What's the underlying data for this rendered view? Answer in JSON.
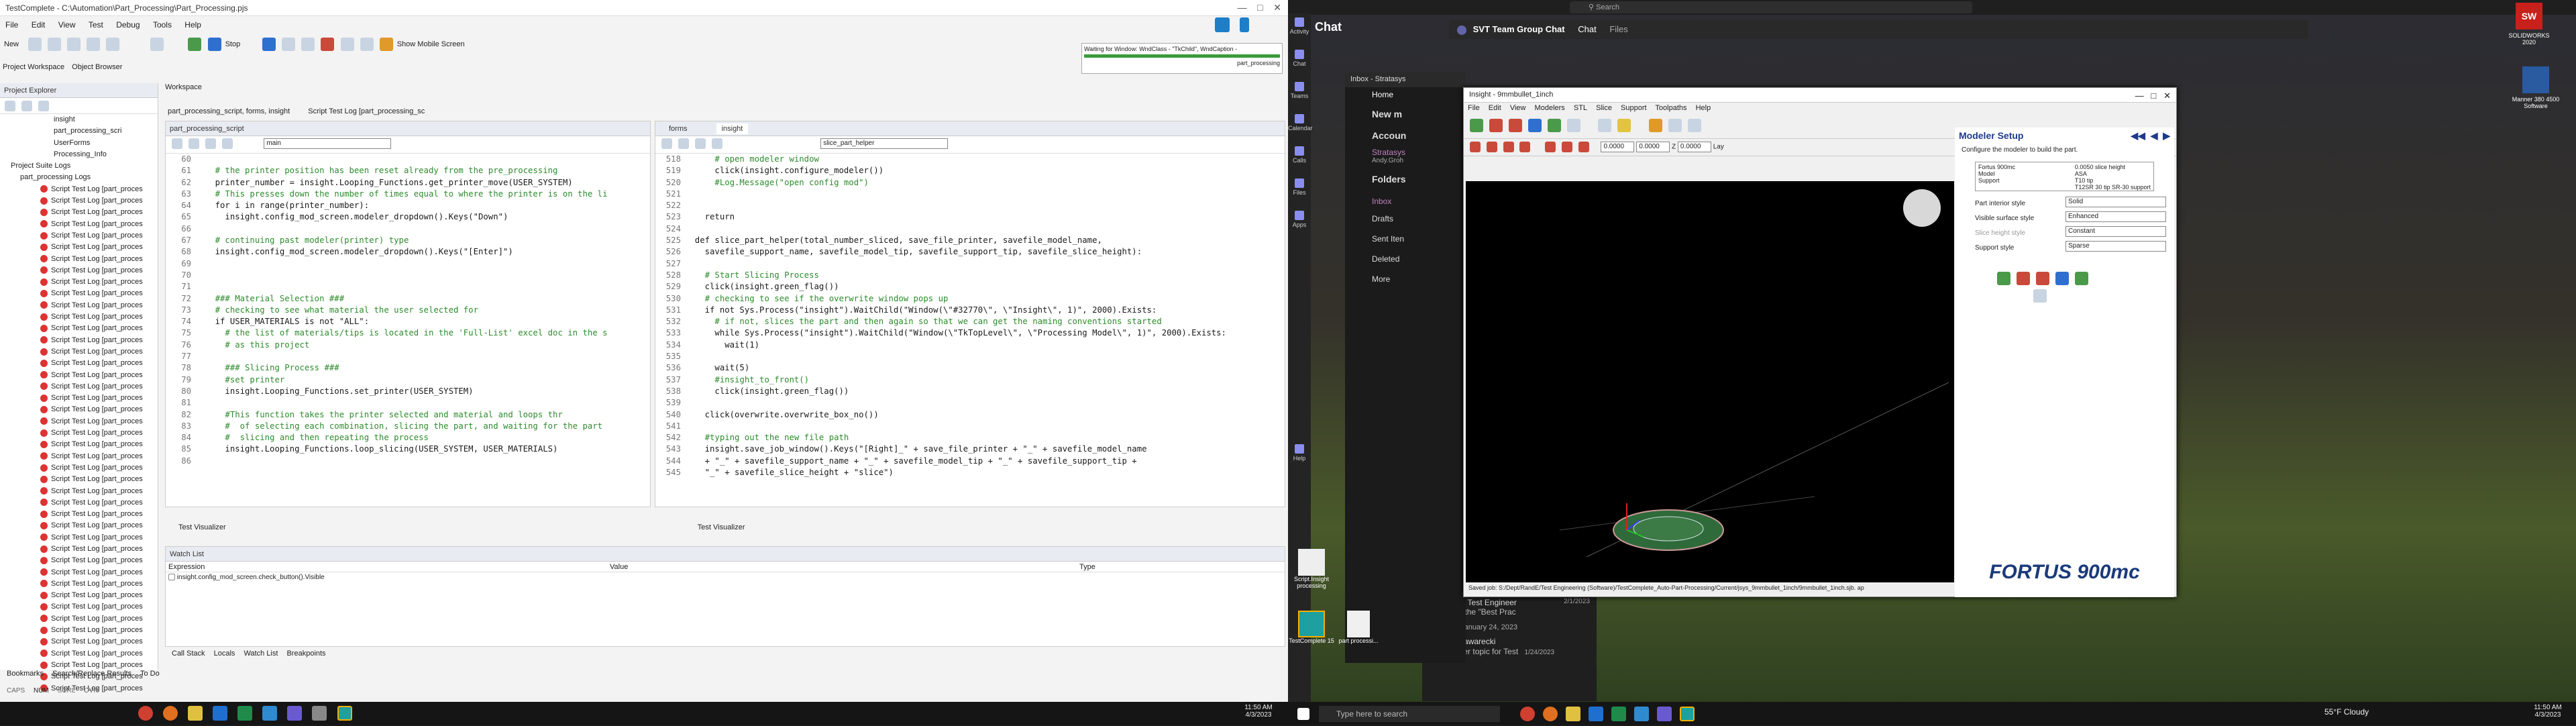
{
  "left_window": {
    "title": "TestComplete - C:\\Automation\\Part_Processing\\Part_Processing.pjs",
    "menu": [
      "File",
      "Edit",
      "View",
      "Test",
      "Debug",
      "Tools",
      "Help"
    ],
    "toolbar": {
      "new_label": "New",
      "run_label": "Run",
      "stop_label": "Stop",
      "mobile_label": "Show Mobile Screen"
    },
    "waiting_text": "Waiting for Window: WndClass - \"TkChild\", WndCaption -",
    "waiting_sub": "part_processing",
    "tabs_left": [
      "Project Workspace",
      "Object Browser"
    ],
    "workspace_label": "Workspace",
    "project_explorer": {
      "title": "Project Explorer",
      "items_top": [
        "insight",
        "part_processing_scri",
        "UserForms",
        "Processing_Info"
      ],
      "suite_logs": "Project Suite Logs",
      "logs_parent": "part_processing Logs",
      "log_item": "Script Test Log [part_proces",
      "log_count": 44
    },
    "editor_tabs": [
      "part_processing_script, forms, insight",
      "Script Test Log [part_processing_sc"
    ],
    "left_editor": {
      "tab": "part_processing_script",
      "routine": "main",
      "lines": [
        {
          "n": "60",
          "t": ""
        },
        {
          "n": "61",
          "t": "    # the printer position has been reset already from the pre_processing",
          "c": "cmt"
        },
        {
          "n": "62",
          "t": "    printer_number = insight.Looping_Functions.get_printer_move(USER_SYSTEM)"
        },
        {
          "n": "63",
          "t": "    # This presses down the number of times equal to where the printer is on the li",
          "c": "cmt"
        },
        {
          "n": "64",
          "t": "    for i in range(printer_number):"
        },
        {
          "n": "65",
          "t": "      insight.config_mod_screen.modeler_dropdown().Keys(\"Down\")"
        },
        {
          "n": "66",
          "t": ""
        },
        {
          "n": "67",
          "t": "    # continuing past modeler(printer) type",
          "c": "cmt"
        },
        {
          "n": "68",
          "t": "    insight.config_mod_screen.modeler_dropdown().Keys(\"[Enter]\")"
        },
        {
          "n": "69",
          "t": ""
        },
        {
          "n": "70",
          "t": ""
        },
        {
          "n": "71",
          "t": ""
        },
        {
          "n": "72",
          "t": "    ### Material Selection ###",
          "c": "cmt"
        },
        {
          "n": "73",
          "t": "    # checking to see what material the user selected for",
          "c": "cmt"
        },
        {
          "n": "74",
          "t": "    if USER_MATERIALS is not \"ALL\":"
        },
        {
          "n": "75",
          "t": "      # the list of materials/tips is located in the 'Full-List' excel doc in the s",
          "c": "cmt"
        },
        {
          "n": "76",
          "t": "      # as this project",
          "c": "cmt"
        },
        {
          "n": "77",
          "t": ""
        },
        {
          "n": "78",
          "t": "      ### Slicing Process ###",
          "c": "cmt"
        },
        {
          "n": "79",
          "t": "      #set printer",
          "c": "cmt"
        },
        {
          "n": "80",
          "t": "      insight.Looping_Functions.set_printer(USER_SYSTEM)"
        },
        {
          "n": "81",
          "t": ""
        },
        {
          "n": "82",
          "t": "      #This function takes the printer selected and material and loops thr",
          "c": "cmt"
        },
        {
          "n": "83",
          "t": "      #  of selecting each combination, slicing the part, and waiting for the part",
          "c": "cmt"
        },
        {
          "n": "84",
          "t": "      #  slicing and then repeating the process",
          "c": "cmt"
        },
        {
          "n": "85",
          "t": "      insight.Looping_Functions.loop_slicing(USER_SYSTEM, USER_MATERIALS)"
        },
        {
          "n": "86",
          "t": ""
        }
      ]
    },
    "right_editor": {
      "tabs": [
        "forms",
        "insight"
      ],
      "routine": "slice_part_helper",
      "lines": [
        {
          "n": "518",
          "t": "      # open modeler window",
          "c": "cmt"
        },
        {
          "n": "519",
          "t": "      click(insight.configure_modeler())"
        },
        {
          "n": "520",
          "t": "      #Log.Message(\"open config mod\")",
          "c": "cmt"
        },
        {
          "n": "521",
          "t": ""
        },
        {
          "n": "522",
          "t": ""
        },
        {
          "n": "523",
          "t": "    return"
        },
        {
          "n": "524",
          "t": ""
        },
        {
          "n": "525",
          "t": "  def slice_part_helper(total_number_sliced, save_file_printer, savefile_model_name,"
        },
        {
          "n": "526",
          "t": "    savefile_support_name, savefile_model_tip, savefile_support_tip, savefile_slice_height):"
        },
        {
          "n": "527",
          "t": ""
        },
        {
          "n": "528",
          "t": "    # Start Slicing Process",
          "c": "cmt"
        },
        {
          "n": "529",
          "t": "    click(insight.green_flag())"
        },
        {
          "n": "530",
          "t": "    # checking to see if the overwrite window pops up",
          "c": "cmt"
        },
        {
          "n": "531",
          "t": "    if not Sys.Process(\"insight\").WaitChild(\"Window(\\\"#32770\\\", \\\"Insight\\\", 1)\", 2000).Exists:"
        },
        {
          "n": "532",
          "t": "      # if not, slices the part and then again so that we can get the naming conventions started",
          "c": "cmt"
        },
        {
          "n": "533",
          "t": "      while Sys.Process(\"insight\").WaitChild(\"Window(\\\"TkTopLevel\\\", \\\"Processing Model\\\", 1)\", 2000).Exists:"
        },
        {
          "n": "534",
          "t": "        wait(1)"
        },
        {
          "n": "535",
          "t": ""
        },
        {
          "n": "536",
          "t": "      wait(5)"
        },
        {
          "n": "537",
          "t": "      #insight_to_front()",
          "c": "cmt"
        },
        {
          "n": "538",
          "t": "      click(insight.green_flag())"
        },
        {
          "n": "539",
          "t": ""
        },
        {
          "n": "540",
          "t": "    click(overwrite.overwrite_box_no())"
        },
        {
          "n": "541",
          "t": ""
        },
        {
          "n": "542",
          "t": "    #typing out the new file path",
          "c": "cmt"
        },
        {
          "n": "543",
          "t": "    insight.save_job_window().Keys(\"[Right]_\" + save_file_printer + \"_\" + savefile_model_name"
        },
        {
          "n": "544",
          "t": "    + \"_\" + savefile_support_name + \"_\" + savefile_model_tip + \"_\" + savefile_support_tip +"
        },
        {
          "n": "545",
          "t": "    \"_\" + savefile_slice_height + \"slice\")"
        }
      ]
    },
    "test_visualizer_label": "Test Visualizer",
    "watch": {
      "title": "Watch List",
      "cols": [
        "Expression",
        "Value",
        "Type"
      ],
      "row": "insight.config_mod_screen.check_button().Visible"
    },
    "bottom_tabs": [
      "Call Stack",
      "Locals",
      "Watch List",
      "Breakpoints"
    ],
    "footer_tabs": [
      "Bookmarks",
      "Search/Replace Results",
      "To Do"
    ],
    "status": [
      "CAPS",
      "NUM",
      "SCRL",
      "OVR"
    ]
  },
  "left_taskbar": {
    "time": "11:50 AM",
    "date": "4/3/2023"
  },
  "right_monitor": {
    "search_placeholder": "Search",
    "teams": {
      "chat_label": "Chat",
      "header": "SVT Team Group Chat",
      "header_tabs": [
        "Chat",
        "Files"
      ],
      "rail": [
        "Activity",
        "Chat",
        "Teams",
        "Calendar",
        "Calls",
        "Files",
        "Apps",
        "Help"
      ],
      "msg1_name": "FW: [FDM Test Engineer",
      "msg1_date": "2/1/2023",
      "msg1_text": "I updated the \"Best Prac",
      "date_sep": "Tuesday, January 24, 2023",
      "msg2_name": "Dan Gawarecki",
      "msg2_text": "Another topic for Test",
      "msg2_date": "1/24/2023"
    },
    "outlook": {
      "title": "Inbox - Stratasys",
      "home": "Home",
      "new_label": "New m",
      "account": "Accoun",
      "account_sub": "Stratasys",
      "account_email": "Andy.Groh",
      "folders": "Folders",
      "folder_items": [
        "Inbox",
        "Drafts",
        "Sent Iten",
        "Deleted",
        "More"
      ]
    },
    "insight": {
      "title": "Insight - 9mmbullet_1inch",
      "menu": [
        "File",
        "Edit",
        "View",
        "Modelers",
        "STL",
        "Slice",
        "Support",
        "Toolpaths",
        "Help"
      ],
      "fields": [
        "0.0000",
        "0.0000",
        "0.0000"
      ],
      "z_label": "Z",
      "lay_label": "Lay",
      "status": "Saved job:  S:/Dept/RandE/Test Engineering (Software)/TestComplete_Auto-Part-Processing/Current/jsys_9mmbullet_1inch/9mmbullet_1inch.sjb.  ap"
    },
    "modeler": {
      "title": "Modeler Setup",
      "desc": "Configure the modeler to build the part.",
      "info_left": [
        "Fortus 900mc",
        "Model",
        "Support"
      ],
      "info_right": [
        "0.0050 slice height",
        "ASA",
        "T10 tip",
        "T12SR 30 tip",
        "SR-30 support"
      ],
      "settings": [
        {
          "label": "Part interior style",
          "value": "Solid"
        },
        {
          "label": "Visible surface style",
          "value": "Enhanced"
        },
        {
          "label": "Slice height style",
          "value": "Constant"
        },
        {
          "label": "Support style",
          "value": "Sparse"
        }
      ],
      "brand": "FORTUS 900mc"
    },
    "desktop_icons": [
      {
        "label": "SOLIDWORKS 2020"
      },
      {
        "label": "Manner 380 4500 Software"
      },
      {
        "label": "Script.Insight processing"
      },
      {
        "label": "TestComplete 15"
      },
      {
        "label": "part processi..."
      }
    ]
  },
  "right_taskbar": {
    "search": "Type here to search",
    "weather": "55°F  Cloudy",
    "time": "11:50 AM",
    "date": "4/3/2023"
  }
}
